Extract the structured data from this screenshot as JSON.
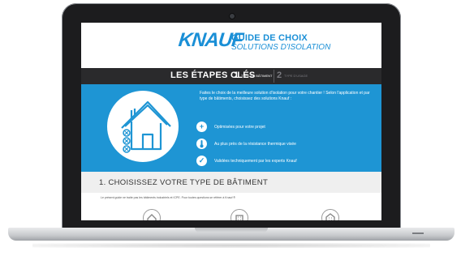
{
  "header": {
    "brand": "KNAUF",
    "guide_line1": "GUIDE DE CHOIX",
    "guide_line2": "SOLUTIONS D'ISOLATION"
  },
  "steps_bar": {
    "title": "LES ÉTAPES CLÉS",
    "step1_num": "1",
    "step1_label": "TYPE DE BÂTIMENT",
    "step2_num": "2",
    "step2_label": "TYPE D'USAGE"
  },
  "hero": {
    "intro": "Faites le choix de la meilleure solution d'isolation pour votre chantier ! Selon l'application et par type de bâtiments, choisissez des solutions Knauf :",
    "features": [
      {
        "icon": "plus-icon",
        "glyph": "+",
        "text": "Optimisées pour votre projet"
      },
      {
        "icon": "thermometer-icon",
        "glyph": "🌡",
        "text": "Au plus près de la résistance thermique visée"
      },
      {
        "icon": "check-icon",
        "glyph": "✓",
        "text": "Validées techniquement par les experts Knauf"
      }
    ]
  },
  "section": {
    "title": "1.  CHOISISSEZ VOTRE TYPE DE BÂTIMENT",
    "note": "Le présent guide ne traite pas les bâtiments industriels et ICPE. Pour toutes questions se référer à Knauf ®"
  },
  "colors": {
    "brand_blue": "#1a8fd6",
    "hero_blue": "#1e95d4",
    "bar_dark": "#2a2a2c"
  }
}
